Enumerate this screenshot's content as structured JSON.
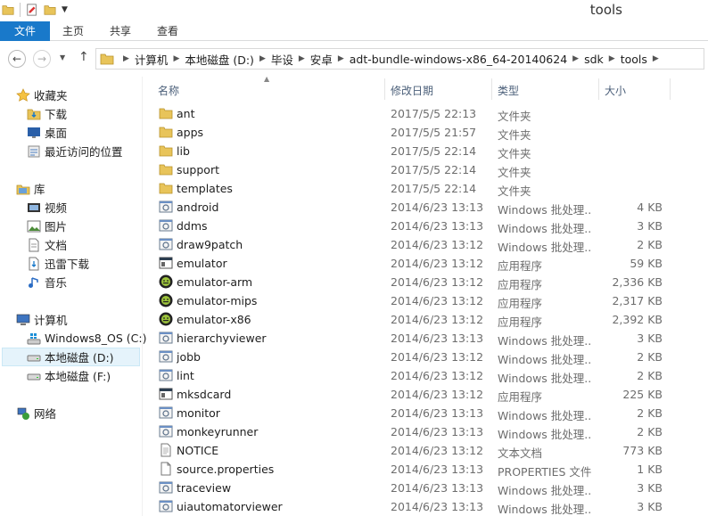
{
  "window": {
    "title": "tools"
  },
  "ribbon": {
    "file_tab": "文件",
    "tabs": [
      "主页",
      "共享",
      "查看"
    ]
  },
  "address": {
    "crumbs": [
      "计算机",
      "本地磁盘 (D:)",
      "毕设",
      "安卓",
      "adt-bundle-windows-x86_64-20140624",
      "sdk",
      "tools"
    ]
  },
  "nav": {
    "favorites": {
      "label": "收藏夹",
      "items": [
        "下载",
        "桌面",
        "最近访问的位置"
      ]
    },
    "libraries": {
      "label": "库",
      "items": [
        "视频",
        "图片",
        "文档",
        "迅雷下载",
        "音乐"
      ]
    },
    "computer": {
      "label": "计算机",
      "items": [
        "Windows8_OS (C:)",
        "本地磁盘 (D:)",
        "本地磁盘 (F:)"
      ]
    },
    "network": {
      "label": "网络"
    }
  },
  "columns": {
    "name": "名称",
    "date": "修改日期",
    "type": "类型",
    "size": "大小"
  },
  "files": [
    {
      "name": "ant",
      "date": "2017/5/5 22:13",
      "type": "文件夹",
      "size": "",
      "icon": "folder-icon"
    },
    {
      "name": "apps",
      "date": "2017/5/5 21:57",
      "type": "文件夹",
      "size": "",
      "icon": "folder-icon"
    },
    {
      "name": "lib",
      "date": "2017/5/5 22:14",
      "type": "文件夹",
      "size": "",
      "icon": "folder-icon"
    },
    {
      "name": "support",
      "date": "2017/5/5 22:14",
      "type": "文件夹",
      "size": "",
      "icon": "folder-icon"
    },
    {
      "name": "templates",
      "date": "2017/5/5 22:14",
      "type": "文件夹",
      "size": "",
      "icon": "folder-icon"
    },
    {
      "name": "android",
      "date": "2014/6/23 13:13",
      "type": "Windows 批处理...",
      "size": "4 KB",
      "icon": "batch-icon"
    },
    {
      "name": "ddms",
      "date": "2014/6/23 13:13",
      "type": "Windows 批处理...",
      "size": "3 KB",
      "icon": "batch-icon"
    },
    {
      "name": "draw9patch",
      "date": "2014/6/23 13:12",
      "type": "Windows 批处理...",
      "size": "2 KB",
      "icon": "batch-icon"
    },
    {
      "name": "emulator",
      "date": "2014/6/23 13:12",
      "type": "应用程序",
      "size": "59 KB",
      "icon": "exe-icon"
    },
    {
      "name": "emulator-arm",
      "date": "2014/6/23 13:12",
      "type": "应用程序",
      "size": "2,336 KB",
      "icon": "android-exe-icon"
    },
    {
      "name": "emulator-mips",
      "date": "2014/6/23 13:12",
      "type": "应用程序",
      "size": "2,317 KB",
      "icon": "android-exe-icon"
    },
    {
      "name": "emulator-x86",
      "date": "2014/6/23 13:12",
      "type": "应用程序",
      "size": "2,392 KB",
      "icon": "android-exe-icon"
    },
    {
      "name": "hierarchyviewer",
      "date": "2014/6/23 13:13",
      "type": "Windows 批处理...",
      "size": "3 KB",
      "icon": "batch-icon"
    },
    {
      "name": "jobb",
      "date": "2014/6/23 13:12",
      "type": "Windows 批处理...",
      "size": "2 KB",
      "icon": "batch-icon"
    },
    {
      "name": "lint",
      "date": "2014/6/23 13:12",
      "type": "Windows 批处理...",
      "size": "2 KB",
      "icon": "batch-icon"
    },
    {
      "name": "mksdcard",
      "date": "2014/6/23 13:12",
      "type": "应用程序",
      "size": "225 KB",
      "icon": "exe-icon"
    },
    {
      "name": "monitor",
      "date": "2014/6/23 13:13",
      "type": "Windows 批处理...",
      "size": "2 KB",
      "icon": "batch-icon"
    },
    {
      "name": "monkeyrunner",
      "date": "2014/6/23 13:13",
      "type": "Windows 批处理...",
      "size": "2 KB",
      "icon": "batch-icon"
    },
    {
      "name": "NOTICE",
      "date": "2014/6/23 13:12",
      "type": "文本文档",
      "size": "773 KB",
      "icon": "text-file-icon"
    },
    {
      "name": "source.properties",
      "date": "2014/6/23 13:13",
      "type": "PROPERTIES 文件",
      "size": "1 KB",
      "icon": "file-icon"
    },
    {
      "name": "traceview",
      "date": "2014/6/23 13:13",
      "type": "Windows 批处理...",
      "size": "3 KB",
      "icon": "batch-icon"
    },
    {
      "name": "uiautomatorviewer",
      "date": "2014/6/23 13:13",
      "type": "Windows 批处理...",
      "size": "3 KB",
      "icon": "batch-icon"
    }
  ],
  "colors": {
    "accent": "#1979ca",
    "folder": "#e8c45a",
    "selection": "#e5f3fb"
  }
}
